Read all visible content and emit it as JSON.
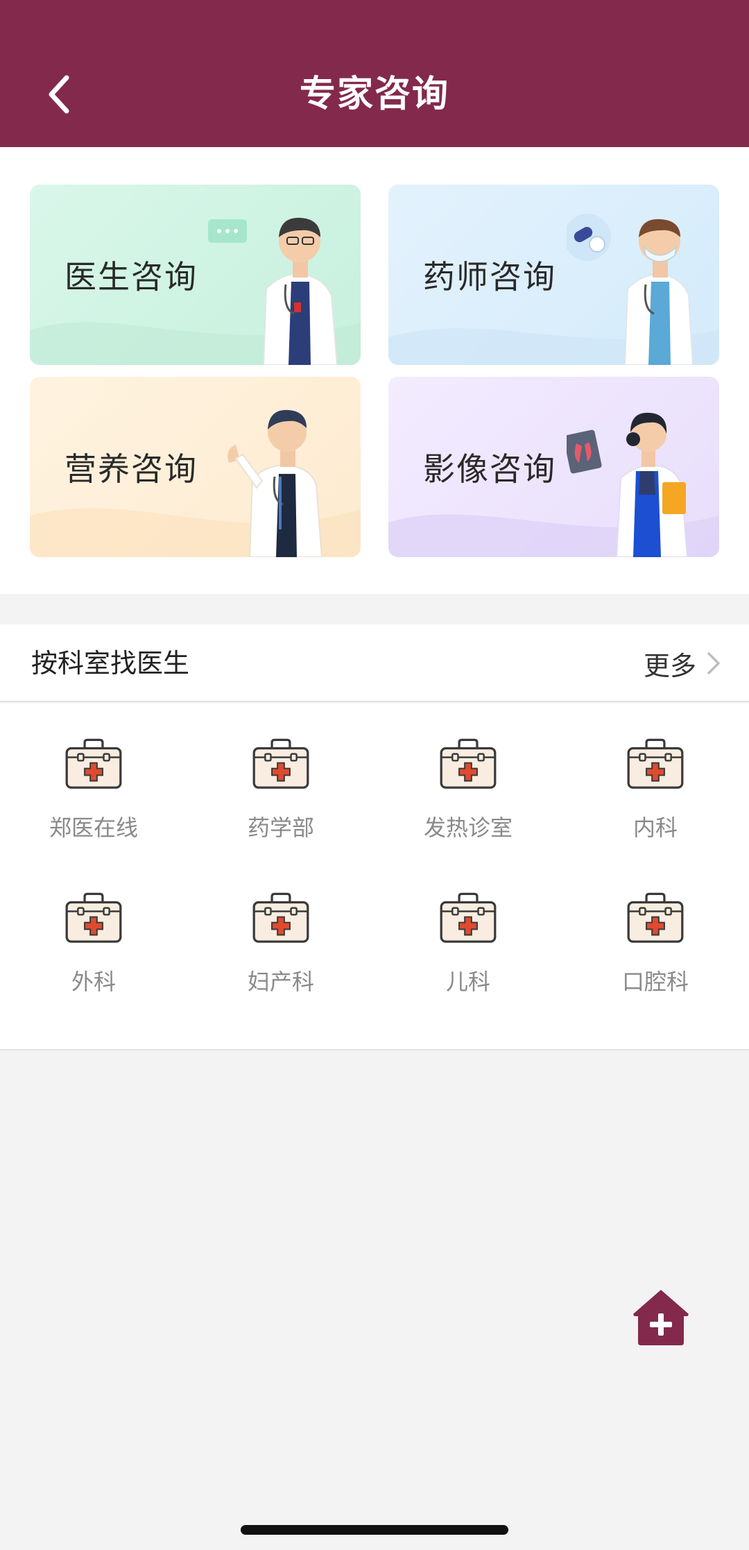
{
  "header": {
    "title": "专家咨询",
    "background_color": "#83294c"
  },
  "consult_cards": [
    {
      "label": "医生咨询",
      "icon": "doctor-chat-illustration"
    },
    {
      "label": "药师咨询",
      "icon": "pharmacist-pill-illustration"
    },
    {
      "label": "营养咨询",
      "icon": "nutritionist-illustration"
    },
    {
      "label": "影像咨询",
      "icon": "radiology-xray-illustration"
    }
  ],
  "department_section": {
    "title": "按科室找医生",
    "more_label": "更多",
    "departments": [
      {
        "label": "郑医在线",
        "icon": "medical-kit-icon"
      },
      {
        "label": "药学部",
        "icon": "medical-kit-icon"
      },
      {
        "label": "发热诊室",
        "icon": "medical-kit-icon"
      },
      {
        "label": "内科",
        "icon": "medical-kit-icon"
      },
      {
        "label": "外科",
        "icon": "medical-kit-icon"
      },
      {
        "label": "妇产科",
        "icon": "medical-kit-icon"
      },
      {
        "label": "儿科",
        "icon": "medical-kit-icon"
      },
      {
        "label": "口腔科",
        "icon": "medical-kit-icon"
      }
    ]
  },
  "floating_button": {
    "icon": "home-plus-icon",
    "color": "#83294c"
  }
}
